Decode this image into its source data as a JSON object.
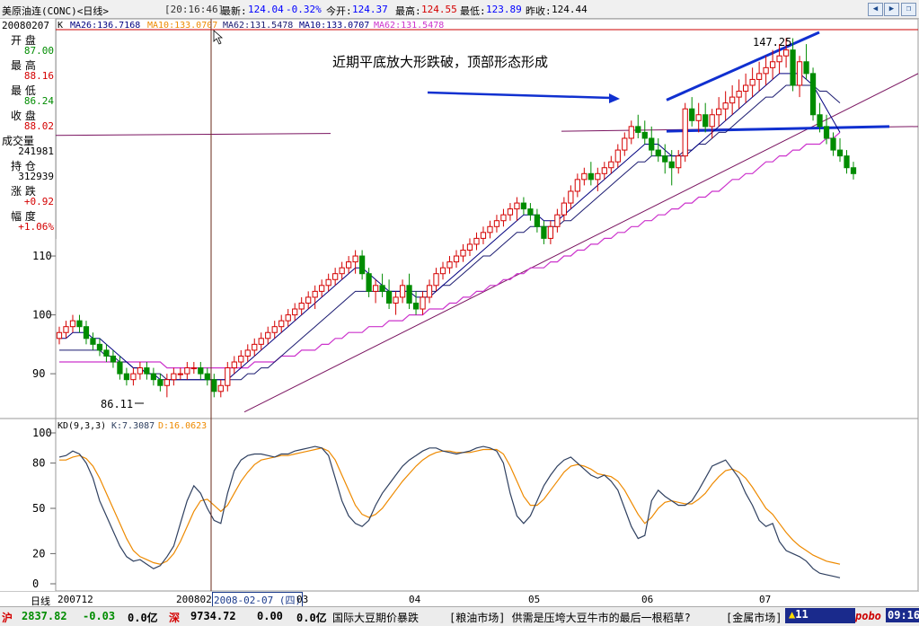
{
  "titlebar": {
    "instrument": "美原油连(CONC)<日线>",
    "time": "[20:16:46]",
    "latest_label": "最新:",
    "latest": "124.04",
    "change": "-0.32%",
    "open_label": "今开:",
    "open": "124.37",
    "high_label": "最高:",
    "high": "124.55",
    "low_label": "最低:",
    "low": "123.89",
    "prev_label": "昨收:",
    "prev": "124.44"
  },
  "info_panel": {
    "date": "20080207",
    "open_label": "开  盘",
    "open": "87.00",
    "high_label": "最  高",
    "high": "88.16",
    "low_label": "最  低",
    "low": "86.24",
    "close_label": "收  盘",
    "close": "88.02",
    "volume_label": "成交量",
    "volume": "241981",
    "oi_label": "持  仓",
    "oi": "312939",
    "chg_label": "涨  跌",
    "chg": "+0.92",
    "pct_label": "幅  度",
    "pct": "+1.06%"
  },
  "ma_header": {
    "k": "K",
    "ma26": "MA26:136.7168",
    "ma10": "MA10:133.0707",
    "ma62a": "MA62:131.5478",
    "ma10b": "MA10:133.0707",
    "ma62b": "MA62:131.5478"
  },
  "kd_header": {
    "name": "KD(9,3,3)",
    "k": "K:7.3087",
    "d": "D:16.0623"
  },
  "annotation": {
    "text": "近期平底放大形跌破，顶部形态形成"
  },
  "bottom_axis": {
    "label": "日线",
    "ticks": [
      "200712",
      "200802",
      "2008-02-07 (四)",
      "03",
      "04",
      "05",
      "06",
      "07"
    ]
  },
  "statusbar": {
    "sh_label": "沪",
    "sh_val": "2837.82",
    "sh_chg": "-0.03",
    "sh_amt": "0.0亿",
    "sz_label": "深",
    "sz_val": "9734.72",
    "sz_chg": "0.00",
    "sz_amt": "0.0亿",
    "news1": "国际大豆期价暴跌",
    "news2": "[粮油市场] 供需是压垮大豆牛市的最后一根稻草?",
    "news3": "[金属市场]",
    "alert": "11",
    "brand": "pobo",
    "clock": "09:16"
  },
  "colors": {
    "up": "#d40000",
    "down": "#008c00",
    "ma_short": "#000080",
    "ma_mid": "#1a1a70",
    "ma_long": "#cc33cc",
    "k_line": "#2f4060",
    "d_line": "#ee8a00",
    "trend": "#7a1460",
    "annot_line": "#1030d0"
  },
  "chart_data": {
    "type": "candlestick",
    "price_axis": {
      "ticks": [
        90,
        100,
        110
      ],
      "range": [
        83,
        148
      ]
    },
    "kd_axis": {
      "ticks": [
        0,
        20,
        50,
        80,
        100
      ],
      "range": [
        0,
        100
      ]
    },
    "labels": {
      "low_mark": "86.11",
      "high_mark": "147.25"
    },
    "x_month_ticks": [
      "200712",
      "200802",
      "03",
      "04",
      "05",
      "06",
      "07"
    ],
    "candles": [
      [
        96,
        98,
        95,
        97
      ],
      [
        97,
        99,
        96,
        98
      ],
      [
        98,
        100,
        97,
        99
      ],
      [
        99,
        100,
        97,
        98
      ],
      [
        98,
        99,
        95,
        96
      ],
      [
        96,
        97,
        94,
        95
      ],
      [
        95,
        96,
        93,
        94
      ],
      [
        94,
        95,
        92,
        93
      ],
      [
        93,
        94,
        91,
        92
      ],
      [
        92,
        93,
        89,
        90
      ],
      [
        90,
        91,
        88,
        89
      ],
      [
        89,
        91,
        88,
        90
      ],
      [
        90,
        92,
        89,
        91
      ],
      [
        91,
        92,
        89,
        90
      ],
      [
        90,
        91,
        88,
        89
      ],
      [
        89,
        90,
        87,
        88
      ],
      [
        88,
        90,
        86,
        89
      ],
      [
        89,
        91,
        88,
        90
      ],
      [
        90,
        91,
        89,
        90
      ],
      [
        90,
        92,
        89,
        91
      ],
      [
        91,
        92,
        90,
        91
      ],
      [
        91,
        92,
        89,
        90
      ],
      [
        90,
        91,
        88,
        89
      ],
      [
        89,
        90,
        86,
        87
      ],
      [
        87,
        89,
        86,
        88
      ],
      [
        88,
        92,
        87,
        91
      ],
      [
        91,
        93,
        90,
        92
      ],
      [
        92,
        94,
        91,
        93
      ],
      [
        93,
        95,
        92,
        94
      ],
      [
        94,
        96,
        93,
        95
      ],
      [
        95,
        97,
        94,
        96
      ],
      [
        96,
        98,
        95,
        97
      ],
      [
        97,
        99,
        96,
        98
      ],
      [
        98,
        100,
        97,
        99
      ],
      [
        99,
        101,
        98,
        100
      ],
      [
        100,
        102,
        99,
        101
      ],
      [
        101,
        103,
        100,
        102
      ],
      [
        102,
        104,
        101,
        103
      ],
      [
        103,
        105,
        101,
        104
      ],
      [
        104,
        106,
        103,
        105
      ],
      [
        105,
        107,
        104,
        106
      ],
      [
        106,
        108,
        105,
        107
      ],
      [
        107,
        109,
        106,
        108
      ],
      [
        108,
        110,
        107,
        109
      ],
      [
        109,
        111,
        107,
        110
      ],
      [
        110,
        111,
        106,
        107
      ],
      [
        107,
        108,
        103,
        104
      ],
      [
        104,
        106,
        102,
        105
      ],
      [
        105,
        107,
        103,
        104
      ],
      [
        104,
        106,
        101,
        102
      ],
      [
        102,
        104,
        100,
        103
      ],
      [
        103,
        106,
        102,
        105
      ],
      [
        105,
        107,
        101,
        102
      ],
      [
        102,
        104,
        100,
        101
      ],
      [
        101,
        104,
        100,
        103
      ],
      [
        103,
        106,
        102,
        105
      ],
      [
        105,
        108,
        104,
        107
      ],
      [
        107,
        109,
        106,
        108
      ],
      [
        108,
        110,
        107,
        109
      ],
      [
        109,
        111,
        108,
        110
      ],
      [
        110,
        112,
        109,
        111
      ],
      [
        111,
        113,
        110,
        112
      ],
      [
        112,
        114,
        111,
        113
      ],
      [
        113,
        115,
        112,
        114
      ],
      [
        114,
        116,
        113,
        115
      ],
      [
        115,
        117,
        114,
        116
      ],
      [
        116,
        118,
        115,
        117
      ],
      [
        117,
        119,
        116,
        118
      ],
      [
        118,
        120,
        116,
        119
      ],
      [
        119,
        120,
        117,
        118
      ],
      [
        118,
        119,
        116,
        117
      ],
      [
        117,
        118,
        114,
        115
      ],
      [
        115,
        116,
        112,
        113
      ],
      [
        113,
        116,
        112,
        115
      ],
      [
        115,
        118,
        114,
        117
      ],
      [
        117,
        120,
        116,
        119
      ],
      [
        119,
        122,
        118,
        121
      ],
      [
        121,
        124,
        120,
        123
      ],
      [
        123,
        125,
        122,
        124
      ],
      [
        124,
        126,
        122,
        123
      ],
      [
        123,
        125,
        121,
        124
      ],
      [
        124,
        126,
        123,
        125
      ],
      [
        125,
        127,
        124,
        126
      ],
      [
        126,
        129,
        125,
        128
      ],
      [
        128,
        131,
        127,
        130
      ],
      [
        130,
        133,
        129,
        132
      ],
      [
        132,
        134,
        130,
        131
      ],
      [
        131,
        133,
        129,
        130
      ],
      [
        130,
        132,
        127,
        128
      ],
      [
        128,
        130,
        126,
        127
      ],
      [
        127,
        129,
        124,
        126
      ],
      [
        126,
        128,
        122,
        125
      ],
      [
        125,
        128,
        124,
        127
      ],
      [
        127,
        136,
        126,
        135
      ],
      [
        135,
        137,
        132,
        133
      ],
      [
        133,
        136,
        131,
        134
      ],
      [
        134,
        136,
        131,
        132
      ],
      [
        132,
        135,
        130,
        134
      ],
      [
        134,
        137,
        132,
        135
      ],
      [
        135,
        138,
        133,
        136
      ],
      [
        136,
        139,
        134,
        137
      ],
      [
        137,
        140,
        135,
        138
      ],
      [
        138,
        141,
        136,
        139
      ],
      [
        139,
        142,
        137,
        140
      ],
      [
        140,
        143,
        138,
        141
      ],
      [
        141,
        144,
        139,
        142
      ],
      [
        142,
        145,
        140,
        143
      ],
      [
        143,
        146,
        141,
        144
      ],
      [
        144,
        147,
        142,
        145
      ],
      [
        145,
        147,
        138,
        139
      ],
      [
        139,
        144,
        137,
        143
      ],
      [
        143,
        146,
        140,
        141
      ],
      [
        141,
        142,
        133,
        134
      ],
      [
        134,
        136,
        131,
        132
      ],
      [
        132,
        134,
        129,
        130
      ],
      [
        130,
        131,
        127,
        128
      ],
      [
        128,
        130,
        126,
        127
      ],
      [
        127,
        128,
        124,
        125
      ],
      [
        125,
        126,
        123,
        124
      ]
    ],
    "ma_short": [
      96,
      96,
      97,
      97,
      97,
      96,
      96,
      95,
      94,
      93,
      92,
      91,
      91,
      90,
      90,
      89,
      89,
      89,
      89,
      89,
      89,
      89,
      89,
      89,
      89,
      89,
      90,
      91,
      92,
      93,
      94,
      95,
      96,
      97,
      98,
      99,
      100,
      101,
      102,
      103,
      104,
      105,
      106,
      107,
      108,
      108,
      107,
      106,
      105,
      104,
      104,
      104,
      104,
      103,
      103,
      103,
      104,
      105,
      106,
      107,
      108,
      109,
      110,
      111,
      112,
      113,
      114,
      115,
      116,
      117,
      117,
      117,
      116,
      116,
      116,
      117,
      118,
      119,
      120,
      121,
      122,
      123,
      124,
      125,
      126,
      127,
      128,
      129,
      129,
      129,
      128,
      127,
      127,
      127,
      128,
      129,
      130,
      131,
      132,
      133,
      134,
      135,
      136,
      137,
      138,
      139,
      140,
      141,
      141,
      141,
      141,
      140,
      139,
      137,
      135,
      133,
      131
    ],
    "ma_mid": [
      94,
      94,
      94,
      94,
      94,
      94,
      94,
      93,
      93,
      92,
      92,
      91,
      91,
      90,
      90,
      90,
      89,
      89,
      89,
      89,
      89,
      89,
      89,
      89,
      89,
      89,
      89,
      89,
      90,
      90,
      91,
      91,
      92,
      93,
      94,
      95,
      96,
      97,
      98,
      99,
      100,
      101,
      102,
      103,
      104,
      104,
      104,
      104,
      104,
      104,
      104,
      104,
      104,
      104,
      104,
      104,
      104,
      105,
      105,
      106,
      107,
      108,
      109,
      110,
      110,
      111,
      112,
      113,
      114,
      114,
      115,
      115,
      115,
      115,
      115,
      116,
      116,
      117,
      118,
      119,
      120,
      121,
      122,
      123,
      124,
      125,
      126,
      126,
      127,
      127,
      127,
      127,
      127,
      128,
      128,
      129,
      129,
      130,
      131,
      131,
      132,
      133,
      134,
      135,
      136,
      137,
      137,
      138,
      139,
      139,
      139,
      139,
      139,
      138,
      138,
      137,
      136
    ],
    "ma_long": [
      92,
      92,
      92,
      92,
      92,
      92,
      92,
      92,
      92,
      92,
      92,
      92,
      92,
      92,
      92,
      92,
      91,
      91,
      91,
      91,
      91,
      91,
      91,
      91,
      91,
      91,
      91,
      91,
      91,
      92,
      92,
      92,
      92,
      93,
      93,
      93,
      94,
      94,
      94,
      95,
      95,
      96,
      96,
      97,
      97,
      97,
      98,
      98,
      98,
      99,
      99,
      99,
      100,
      100,
      100,
      101,
      101,
      101,
      102,
      102,
      103,
      103,
      104,
      104,
      105,
      105,
      106,
      106,
      107,
      107,
      108,
      108,
      108,
      109,
      109,
      110,
      110,
      111,
      111,
      112,
      112,
      113,
      113,
      114,
      114,
      115,
      115,
      116,
      116,
      117,
      117,
      118,
      118,
      119,
      119,
      120,
      120,
      121,
      121,
      122,
      123,
      123,
      124,
      124,
      125,
      126,
      126,
      127,
      127,
      128,
      128,
      129,
      129,
      129,
      130,
      130,
      131
    ],
    "kd_k": [
      84,
      85,
      88,
      86,
      80,
      70,
      55,
      45,
      35,
      25,
      18,
      15,
      16,
      13,
      10,
      12,
      18,
      25,
      40,
      55,
      65,
      60,
      50,
      42,
      40,
      60,
      75,
      82,
      85,
      86,
      86,
      85,
      84,
      86,
      86,
      88,
      89,
      90,
      91,
      90,
      85,
      70,
      55,
      45,
      40,
      38,
      42,
      52,
      60,
      66,
      72,
      78,
      82,
      85,
      88,
      90,
      90,
      88,
      87,
      86,
      87,
      88,
      90,
      91,
      90,
      88,
      80,
      60,
      45,
      40,
      45,
      55,
      65,
      72,
      78,
      82,
      84,
      80,
      76,
      72,
      70,
      72,
      68,
      62,
      50,
      38,
      30,
      32,
      55,
      62,
      58,
      55,
      52,
      52,
      55,
      62,
      70,
      78,
      80,
      82,
      76,
      70,
      60,
      52,
      42,
      38,
      40,
      28,
      22,
      20,
      18,
      15,
      10,
      7,
      6,
      5,
      4
    ],
    "kd_d": [
      82,
      82,
      84,
      85,
      83,
      78,
      70,
      60,
      50,
      40,
      30,
      22,
      18,
      16,
      14,
      13,
      15,
      20,
      28,
      38,
      48,
      55,
      56,
      52,
      48,
      52,
      60,
      68,
      74,
      79,
      82,
      83,
      84,
      85,
      85,
      86,
      87,
      88,
      89,
      90,
      88,
      82,
      72,
      62,
      52,
      46,
      44,
      46,
      50,
      56,
      62,
      68,
      73,
      78,
      82,
      85,
      87,
      88,
      88,
      87,
      87,
      87,
      88,
      89,
      89,
      89,
      86,
      78,
      68,
      58,
      52,
      52,
      56,
      62,
      68,
      74,
      78,
      79,
      78,
      76,
      73,
      72,
      71,
      68,
      62,
      54,
      46,
      40,
      44,
      50,
      54,
      55,
      54,
      53,
      53,
      56,
      60,
      66,
      71,
      75,
      76,
      74,
      70,
      64,
      57,
      50,
      46,
      40,
      34,
      29,
      25,
      22,
      19,
      17,
      15,
      14,
      13
    ]
  }
}
